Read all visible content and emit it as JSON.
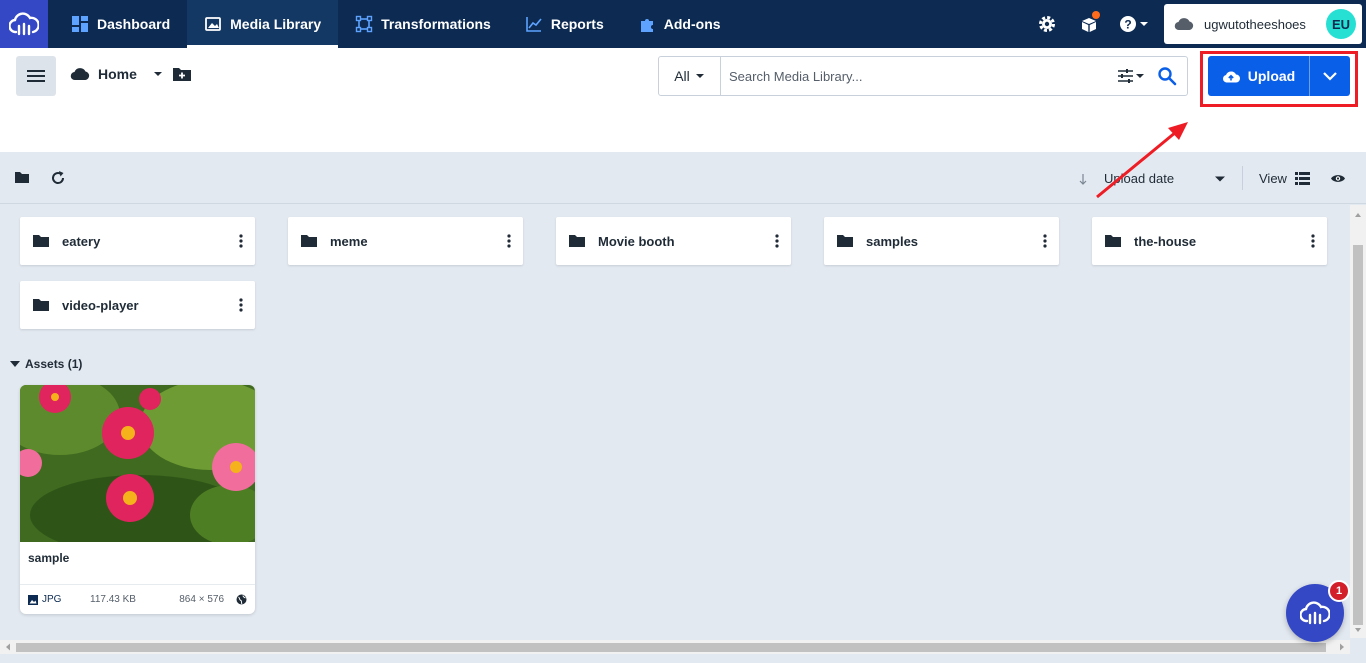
{
  "topnav": {
    "items": [
      {
        "label": "Dashboard",
        "icon": "dashboard-icon",
        "active": false
      },
      {
        "label": "Media Library",
        "icon": "image-icon",
        "active": true
      },
      {
        "label": "Transformations",
        "icon": "transform-icon",
        "active": false
      },
      {
        "label": "Reports",
        "icon": "chart-line-icon",
        "active": false
      },
      {
        "label": "Add-ons",
        "icon": "puzzle-icon",
        "active": false
      }
    ],
    "account_name": "ugwutotheeshoes",
    "avatar_initials": "EU"
  },
  "header": {
    "breadcrumb_home": "Home",
    "search_type": "All",
    "search_placeholder": "Search Media Library...",
    "upload_label": "Upload"
  },
  "toolbar": {
    "sort_label": "Upload date",
    "view_label": "View"
  },
  "folders": [
    "eatery",
    "meme",
    "Movie booth",
    "samples",
    "the-house",
    "video-player"
  ],
  "assets": {
    "section_title": "Assets (1)",
    "items": [
      {
        "name": "sample",
        "type": "JPG",
        "size": "117.43 KB",
        "dimensions": "864 × 576"
      }
    ]
  },
  "help": {
    "badge_count": "1"
  },
  "colors": {
    "nav_bg": "#0c2a52",
    "brand_blue": "#3448c5",
    "upload_blue": "#0a5fe8",
    "highlight_red": "#ee1c24",
    "avatar_teal": "#27e0d4"
  }
}
